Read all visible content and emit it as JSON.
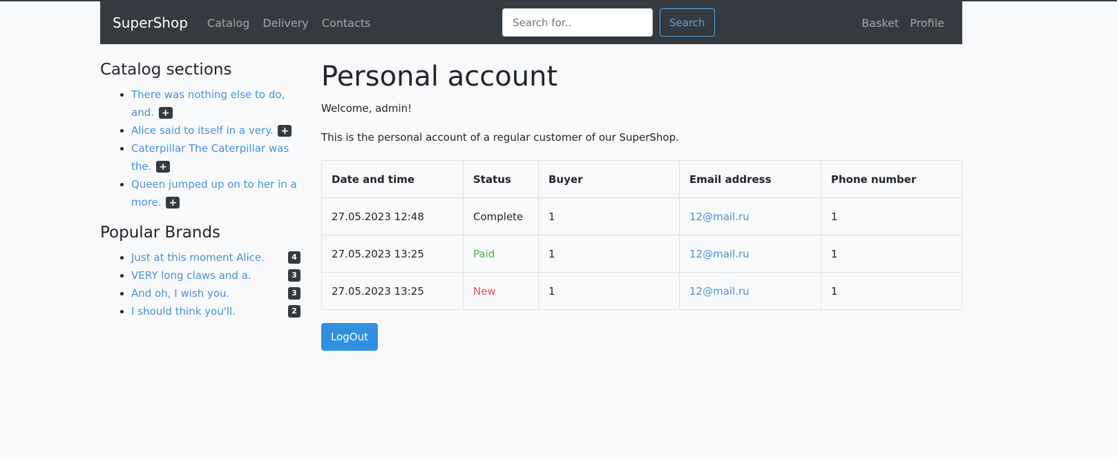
{
  "navbar": {
    "brand": "SuperShop",
    "links": [
      "Catalog",
      "Delivery",
      "Contacts"
    ],
    "search_placeholder": "Search for..",
    "search_button": "Search",
    "right_links": [
      "Basket",
      "Profile"
    ]
  },
  "sidebar": {
    "catalog_title": "Catalog sections",
    "catalog_items": [
      {
        "label": "There was nothing else to do, and.",
        "badge": "+"
      },
      {
        "label": "Alice said to itself in a very.",
        "badge": "+"
      },
      {
        "label": "Caterpillar The Caterpillar was the.",
        "badge": "+"
      },
      {
        "label": "Queen jumped up on to her in a more.",
        "badge": "+"
      }
    ],
    "brands_title": "Popular Brands",
    "brand_items": [
      {
        "label": "Just at this moment Alice.",
        "count": "4"
      },
      {
        "label": "VERY long claws and a.",
        "count": "3"
      },
      {
        "label": "And oh, I wish you.",
        "count": "3"
      },
      {
        "label": "I should think you'll.",
        "count": "2"
      }
    ]
  },
  "main": {
    "title": "Personal account",
    "welcome": "Welcome, admin!",
    "description": "This is the personal account of a regular customer of our SuperShop.",
    "table": {
      "headers": [
        "Date and time",
        "Status",
        "Buyer",
        "Email address",
        "Phone number"
      ],
      "rows": [
        {
          "datetime": "27.05.2023 12:48",
          "status": "Complete",
          "buyer": "1",
          "email": "12@mail.ru",
          "phone": "1"
        },
        {
          "datetime": "27.05.2023 13:25",
          "status": "Paid",
          "buyer": "1",
          "email": "12@mail.ru",
          "phone": "1"
        },
        {
          "datetime": "27.05.2023 13:25",
          "status": "New",
          "buyer": "1",
          "email": "12@mail.ru",
          "phone": "1"
        }
      ]
    },
    "logout_button": "LogOut"
  },
  "colors": {
    "navbar_bg": "#343a40",
    "link": "#4a90d9",
    "status_paid": "#4caf50",
    "status_new": "#d9534f",
    "primary": "#2f8fe0"
  }
}
